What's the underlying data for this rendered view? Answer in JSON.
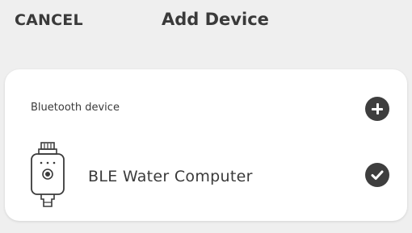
{
  "header": {
    "cancel_label": "CANCEL",
    "title": "Add Device"
  },
  "card": {
    "section_label": "Bluetooth device",
    "add_icon": "plus-icon",
    "device": {
      "icon": "water-computer-device-icon",
      "name": "BLE Water Computer",
      "status_icon": "checkmark-icon"
    }
  },
  "colors": {
    "background": "#efefef",
    "card": "#ffffff",
    "text": "#3a3a3a",
    "icon_fill": "#3e3e3e"
  }
}
